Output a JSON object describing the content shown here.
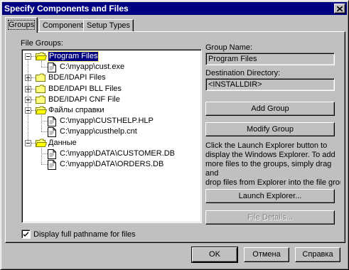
{
  "window": {
    "title": "Specify Components and Files"
  },
  "tabs": [
    {
      "label": "Groups"
    },
    {
      "label": "Components"
    },
    {
      "label": "Setup Types"
    }
  ],
  "file_groups": {
    "label": "File Groups:",
    "items": [
      {
        "label": "Program Files",
        "selected": true,
        "expanded": true,
        "children": [
          "C:\\myapp\\cust.exe"
        ]
      },
      {
        "label": "BDE/IDAPI Files",
        "selected": false,
        "expanded": false,
        "children": []
      },
      {
        "label": "BDE/IDAPI BLL Files",
        "selected": false,
        "expanded": false,
        "children": []
      },
      {
        "label": "BDE/IDAPI CNF File",
        "selected": false,
        "expanded": false,
        "children": []
      },
      {
        "label": "Файлы справки",
        "selected": false,
        "expanded": true,
        "children": [
          "C:\\myapp\\CUSTHELP.HLP",
          "C:\\myapp\\custhelp.cnt"
        ]
      },
      {
        "label": "Данные",
        "selected": false,
        "expanded": true,
        "children": [
          "C:\\myapp\\DATA\\CUSTOMER.DB",
          "C:\\myapp\\DATA\\ORDERS.DB"
        ]
      }
    ]
  },
  "group_name": {
    "label": "Group Name:",
    "value": "Program Files"
  },
  "destination": {
    "label": "Destination Directory:",
    "value": "<INSTALLDIR>"
  },
  "buttons": {
    "add_group": "Add Group",
    "modify_group": "Modify Group",
    "launch_explorer": "Launch Explorer...",
    "file_details": "File Details..."
  },
  "instructions": [
    "Click the Launch Explorer button to",
    "display the Windows Explorer. To add",
    "more files to the groups, simply drag and",
    "drop files from Explorer into the file groups."
  ],
  "checkbox": {
    "label": "Display full pathname for files",
    "checked": true
  },
  "footer": {
    "ok": "OK",
    "cancel": "Отмена",
    "help": "Справка"
  }
}
